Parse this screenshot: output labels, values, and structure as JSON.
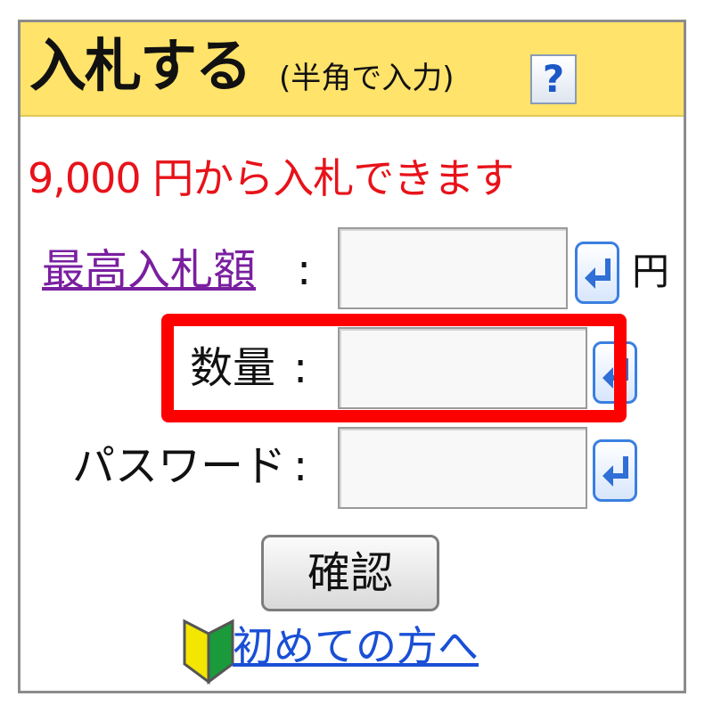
{
  "header": {
    "title": "入札する",
    "subtitle": "(半角で入力)",
    "help_label": "?"
  },
  "notice": "9,000 円から入札できます",
  "fields": {
    "max_bid": {
      "label": "最高入札額",
      "colon": ":",
      "value": "",
      "unit": "円"
    },
    "quantity": {
      "label": "数量",
      "colon": ":",
      "value": ""
    },
    "password": {
      "label": "パスワード",
      "colon": ":",
      "value": ""
    }
  },
  "confirm_label": "確認",
  "beginner_link": "初めての方へ",
  "colors": {
    "header_bg": "#ffe36a",
    "notice": "#e8121a",
    "link_visited": "#7a1fa0",
    "link": "#1a4fd6",
    "highlight": "#ff0000"
  },
  "icons": {
    "help": "help-icon",
    "enter": "enter-arrow-icon",
    "beginner": "beginner-mark-icon"
  }
}
